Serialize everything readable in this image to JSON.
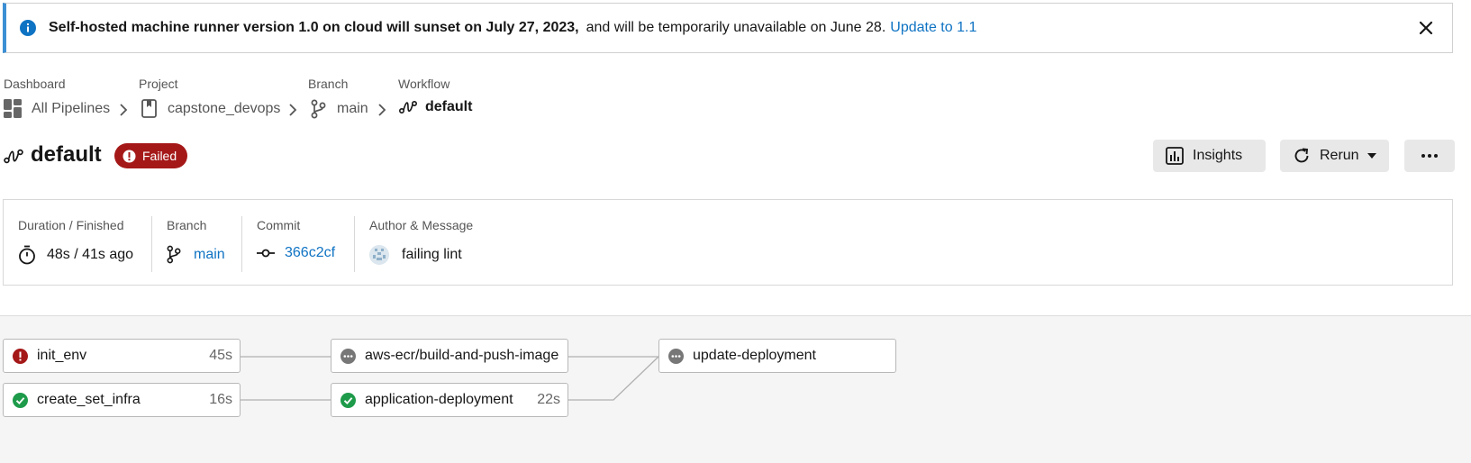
{
  "banner": {
    "bold_text": "Self-hosted machine runner version 1.0 on cloud will sunset on July 27, 2023,",
    "text": "and will be temporarily unavailable on June 28.",
    "link": "Update to 1.1",
    "info_icon": "info-icon",
    "close_icon": "close-icon"
  },
  "breadcrumb": {
    "dashboard": {
      "label": "Dashboard",
      "value": "All Pipelines"
    },
    "project": {
      "label": "Project",
      "value": "capstone_devops"
    },
    "branch": {
      "label": "Branch",
      "value": "main"
    },
    "workflow": {
      "label": "Workflow",
      "value": "default"
    }
  },
  "header": {
    "title": "default",
    "status": "Failed",
    "insights_label": "Insights",
    "rerun_label": "Rerun"
  },
  "summary": {
    "duration": {
      "label": "Duration / Finished",
      "value": "48s / 41s ago"
    },
    "branch": {
      "label": "Branch",
      "value": "main"
    },
    "commit": {
      "label": "Commit",
      "value": "366c2cf"
    },
    "author": {
      "label": "Author & Message",
      "value": "failing lint"
    }
  },
  "jobs": [
    {
      "name": "init_env",
      "duration": "45s",
      "status": "failed"
    },
    {
      "name": "create_set_infra",
      "duration": "16s",
      "status": "success"
    },
    {
      "name": "aws-ecr/build-and-push-image",
      "duration": "",
      "status": "blocked"
    },
    {
      "name": "application-deployment",
      "duration": "22s",
      "status": "success"
    },
    {
      "name": "update-deployment",
      "duration": "",
      "status": "blocked"
    }
  ],
  "colors": {
    "failed": "#a51818",
    "success": "#1e9b4a",
    "blocked": "#777777",
    "link": "#0f73c3",
    "banner_accent": "#3b8fd4"
  }
}
